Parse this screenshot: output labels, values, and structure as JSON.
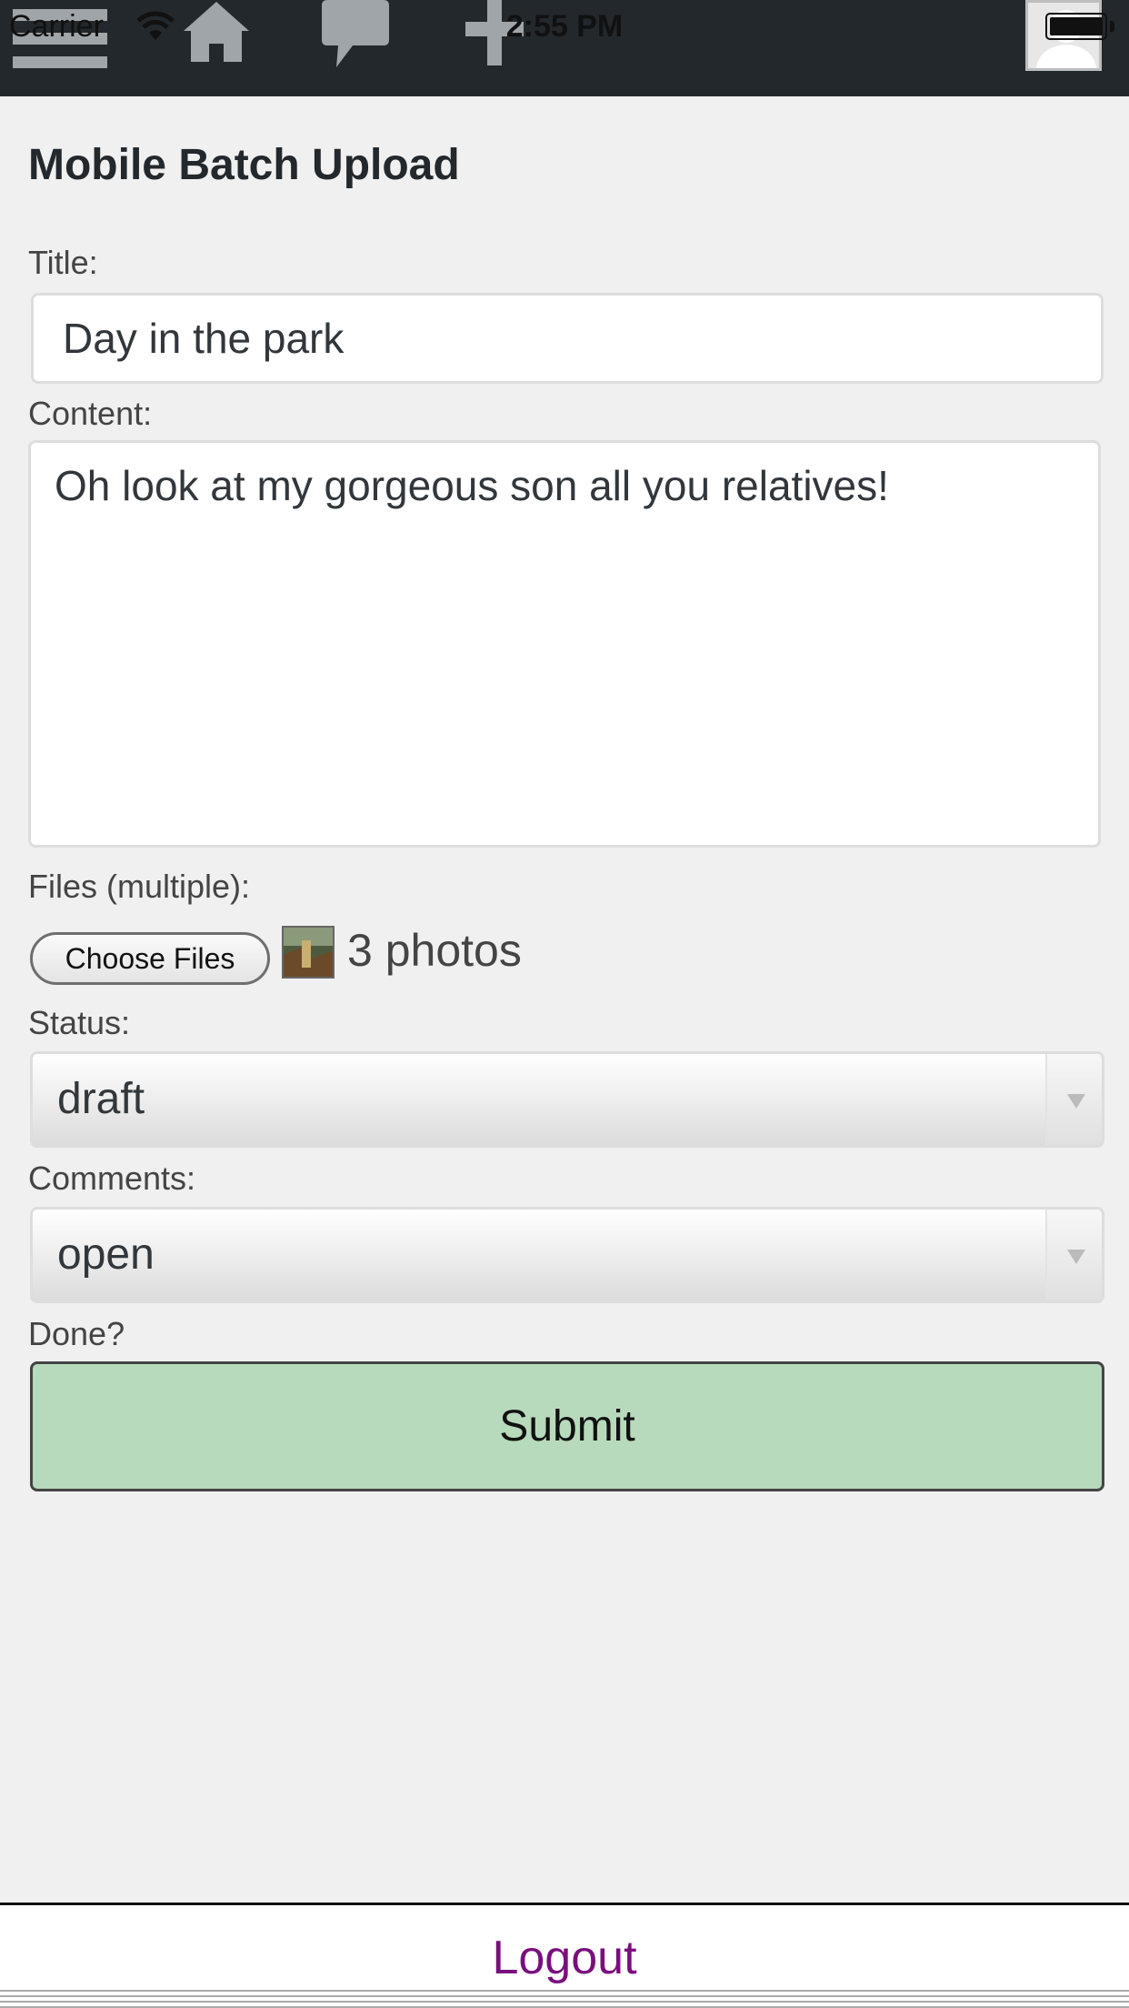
{
  "status_bar": {
    "carrier": "Carrier",
    "time": "2:55 PM"
  },
  "admin_bar": {
    "icons": [
      "menu-icon",
      "home-icon",
      "comment-icon",
      "plus-icon",
      "avatar"
    ]
  },
  "form": {
    "heading": "Mobile Batch Upload",
    "title_label": "Title:",
    "title_value": "Day in the park",
    "content_label": "Content:",
    "content_value": "Oh look at my gorgeous son all you relatives!",
    "files_label": "Files (multiple):",
    "choose_files_label": "Choose Files",
    "files_selected": "3 photos",
    "status_label": "Status:",
    "status_value": "draft",
    "comments_label": "Comments:",
    "comments_value": "open",
    "done_label": "Done?",
    "submit_label": "Submit"
  },
  "footer": {
    "logout_label": "Logout"
  },
  "colors": {
    "admin_bar_bg": "#23282d",
    "submit_bg": "#b8dabc",
    "logout_link": "#7a0e7d",
    "page_bg": "#f0f0f0"
  }
}
